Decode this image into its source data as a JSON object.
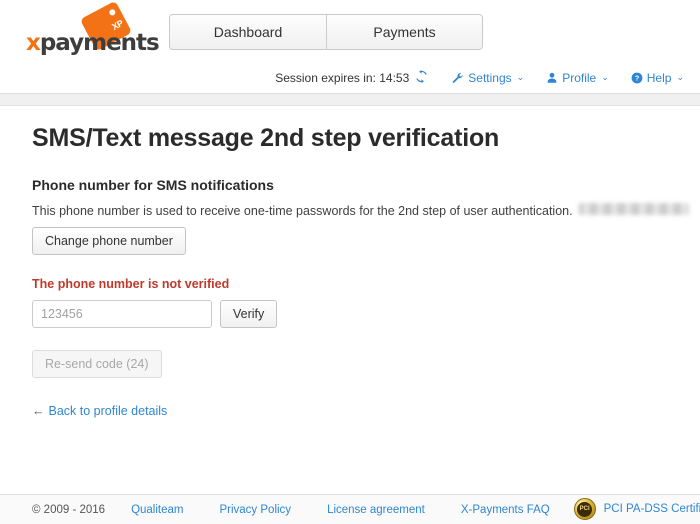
{
  "brand": {
    "logo_x": "x",
    "logo_rest": "payments",
    "logo_tag_label": "XP",
    "accent_color": "#f47216",
    "link_color": "#2f86d3"
  },
  "nav": {
    "tabs": [
      {
        "label": "Dashboard",
        "name": "dashboard"
      },
      {
        "label": "Payments",
        "name": "payments"
      }
    ]
  },
  "session": {
    "label": "Session expires in:",
    "time": "14:53",
    "full_text": "Session expires in: 14:53",
    "refresh_icon": "refresh-icon"
  },
  "usermenu": {
    "items": [
      {
        "label": "Settings",
        "icon": "wrench-icon",
        "caret": "⌄"
      },
      {
        "label": "Profile",
        "icon": "user-icon",
        "caret": "⌄"
      },
      {
        "label": "Help",
        "icon": "question-circle-icon",
        "caret": "⌄"
      }
    ]
  },
  "page": {
    "title": "SMS/Text message 2nd step verification",
    "section_title": "Phone number for SMS notifications",
    "description": "This phone number is used to receive one-time passwords for the 2nd step of user authentication.",
    "phone_number_masked": "",
    "change_phone_button": "Change phone number",
    "error_message": "The phone number is not verified",
    "code_placeholder": "123456",
    "code_value": "",
    "verify_button": "Verify",
    "resend_button": "Re-send code (24)",
    "back_arrow": "←",
    "back_link": "Back to profile details",
    "error_color": "#c0392b"
  },
  "footer": {
    "copyright": "© 2009 - 2016",
    "links": [
      {
        "label": "Qualiteam"
      },
      {
        "label": "Privacy Policy"
      },
      {
        "label": "License agreement"
      },
      {
        "label": "X-Payments FAQ"
      }
    ],
    "pci_seal_label": "PCI",
    "pci_text": "PCI PA-DSS Certified"
  }
}
